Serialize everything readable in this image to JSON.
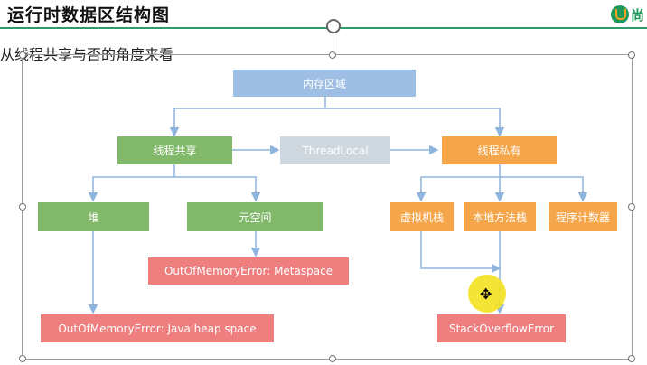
{
  "slide": {
    "title": "运行时数据区结构图",
    "subtitle": "从线程共享与否的角度来看",
    "logo_text": "尚"
  },
  "diagram": {
    "root": "内存区域",
    "shared": "线程共享",
    "threadlocal": "ThreadLocal",
    "private": "线程私有",
    "heap": "堆",
    "metaspace": "元空间",
    "vm_stack": "虚拟机栈",
    "native_stack": "本地方法栈",
    "pc_register": "程序计数器",
    "oom_metaspace": "OutOfMemoryError: Metaspace",
    "oom_heap": "OutOfMemoryError: Java heap space",
    "stack_overflow": "StackOverflowError"
  },
  "colors": {
    "root": "#9fbee3",
    "shared": "#82b86a",
    "threadlocal": "#cfd8df",
    "private": "#f6a64a",
    "error": "#ef7f7f",
    "connector": "#8fb4dd"
  }
}
